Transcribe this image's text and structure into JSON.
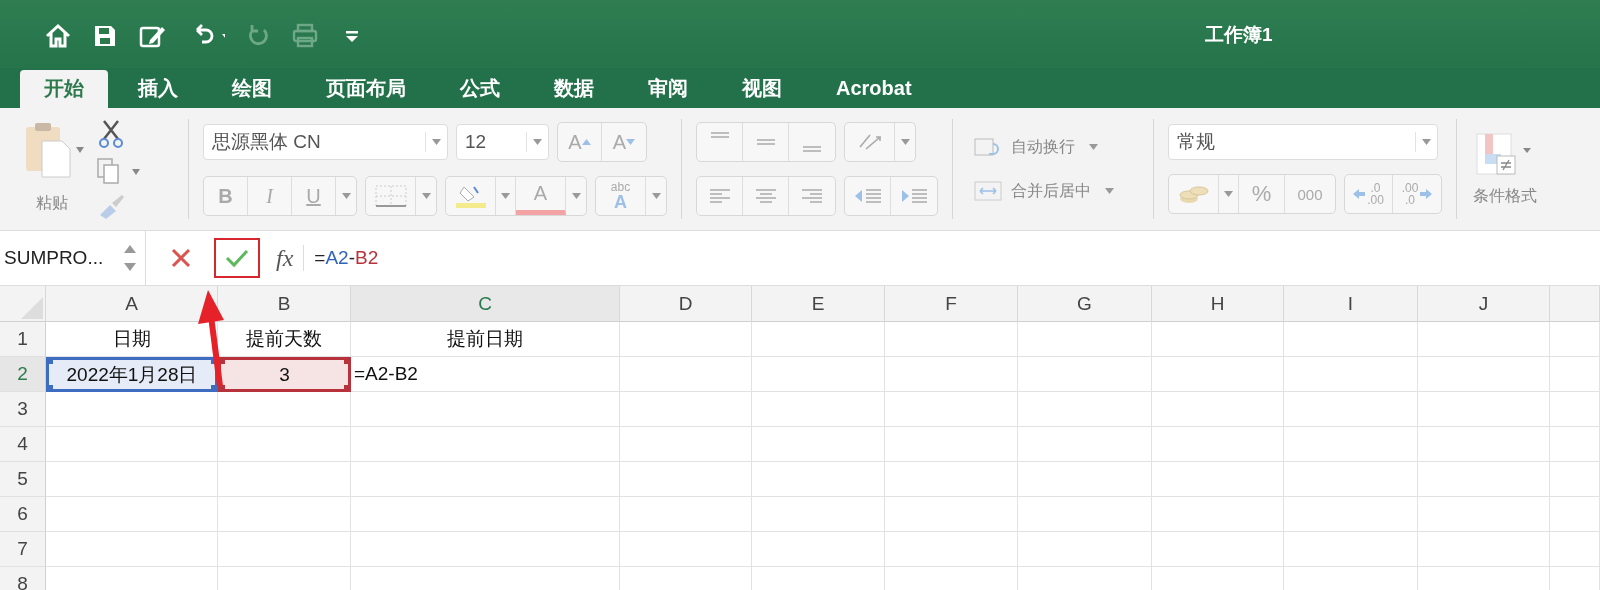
{
  "window": {
    "title": "工作簿1"
  },
  "quick_access": [
    {
      "kind": "home",
      "disabled": false
    },
    {
      "kind": "save",
      "disabled": false
    },
    {
      "kind": "edit",
      "disabled": false
    },
    {
      "kind": "undo",
      "disabled": false
    },
    {
      "kind": "redo",
      "disabled": true
    },
    {
      "kind": "print",
      "disabled": true
    },
    {
      "kind": "customize",
      "disabled": false
    }
  ],
  "tabs": [
    {
      "label": "开始",
      "selected": true
    },
    {
      "label": "插入",
      "selected": false
    },
    {
      "label": "绘图",
      "selected": false
    },
    {
      "label": "页面布局",
      "selected": false
    },
    {
      "label": "公式",
      "selected": false
    },
    {
      "label": "数据",
      "selected": false
    },
    {
      "label": "审阅",
      "selected": false
    },
    {
      "label": "视图",
      "selected": false
    },
    {
      "label": "Acrobat",
      "selected": false
    }
  ],
  "ribbon": {
    "disabled": true,
    "paste_label": "粘贴",
    "font_name": "思源黑体 CN",
    "font_size": "12",
    "grow_font": "A",
    "shrink_font": "A",
    "bold": "B",
    "italic": "I",
    "underline": "U",
    "font_color": "A",
    "phonetic": "abc",
    "phonetic_sub": "A",
    "wrap_text": "自动换行",
    "merge_center": "合并后居中",
    "number_format": "常规",
    "percent": "%",
    "comma": "000",
    "increase_decimal": [
      ".0",
      ".00"
    ],
    "decrease_decimal": [
      ".00",
      ".0"
    ],
    "conditional_format": "条件格式"
  },
  "formula_bar": {
    "name_box": "SUMPRO...",
    "enter_highlighted": true,
    "fx": "fx",
    "formula": [
      {
        "text": "="
      },
      {
        "text": "A2",
        "color": "#2f63b8"
      },
      {
        "text": "-"
      },
      {
        "text": "B2",
        "color": "#b8323c"
      }
    ]
  },
  "pointer_arrow": true,
  "grid": {
    "columns": [
      {
        "label": "A",
        "selected": false
      },
      {
        "label": "B",
        "selected": false
      },
      {
        "label": "C",
        "selected": true
      },
      {
        "label": "D",
        "selected": false
      },
      {
        "label": "E",
        "selected": false
      },
      {
        "label": "F",
        "selected": false
      },
      {
        "label": "G",
        "selected": false
      },
      {
        "label": "H",
        "selected": false
      },
      {
        "label": "I",
        "selected": false
      },
      {
        "label": "J",
        "selected": false
      }
    ],
    "rows": [
      {
        "label": "1",
        "selected": false,
        "cells": [
          {
            "text": "日期",
            "kind": "value"
          },
          {
            "text": "提前天数",
            "kind": "value"
          },
          {
            "text": "提前日期",
            "kind": "value"
          }
        ]
      },
      {
        "label": "2",
        "selected": true,
        "cells": [
          {
            "text": "2022年1月28日",
            "kind": "value",
            "color": "#3d6cc0"
          },
          {
            "text": "3",
            "kind": "value",
            "color": "#b8323c"
          },
          {
            "text": "=A2-B2",
            "kind": "editing"
          }
        ]
      },
      {
        "label": "3",
        "selected": false,
        "cells": []
      },
      {
        "label": "4",
        "selected": false,
        "cells": []
      },
      {
        "label": "5",
        "selected": false,
        "cells": []
      },
      {
        "label": "6",
        "selected": false,
        "cells": []
      },
      {
        "label": "7",
        "selected": false,
        "cells": []
      },
      {
        "label": "8",
        "selected": false,
        "cells": []
      }
    ]
  }
}
